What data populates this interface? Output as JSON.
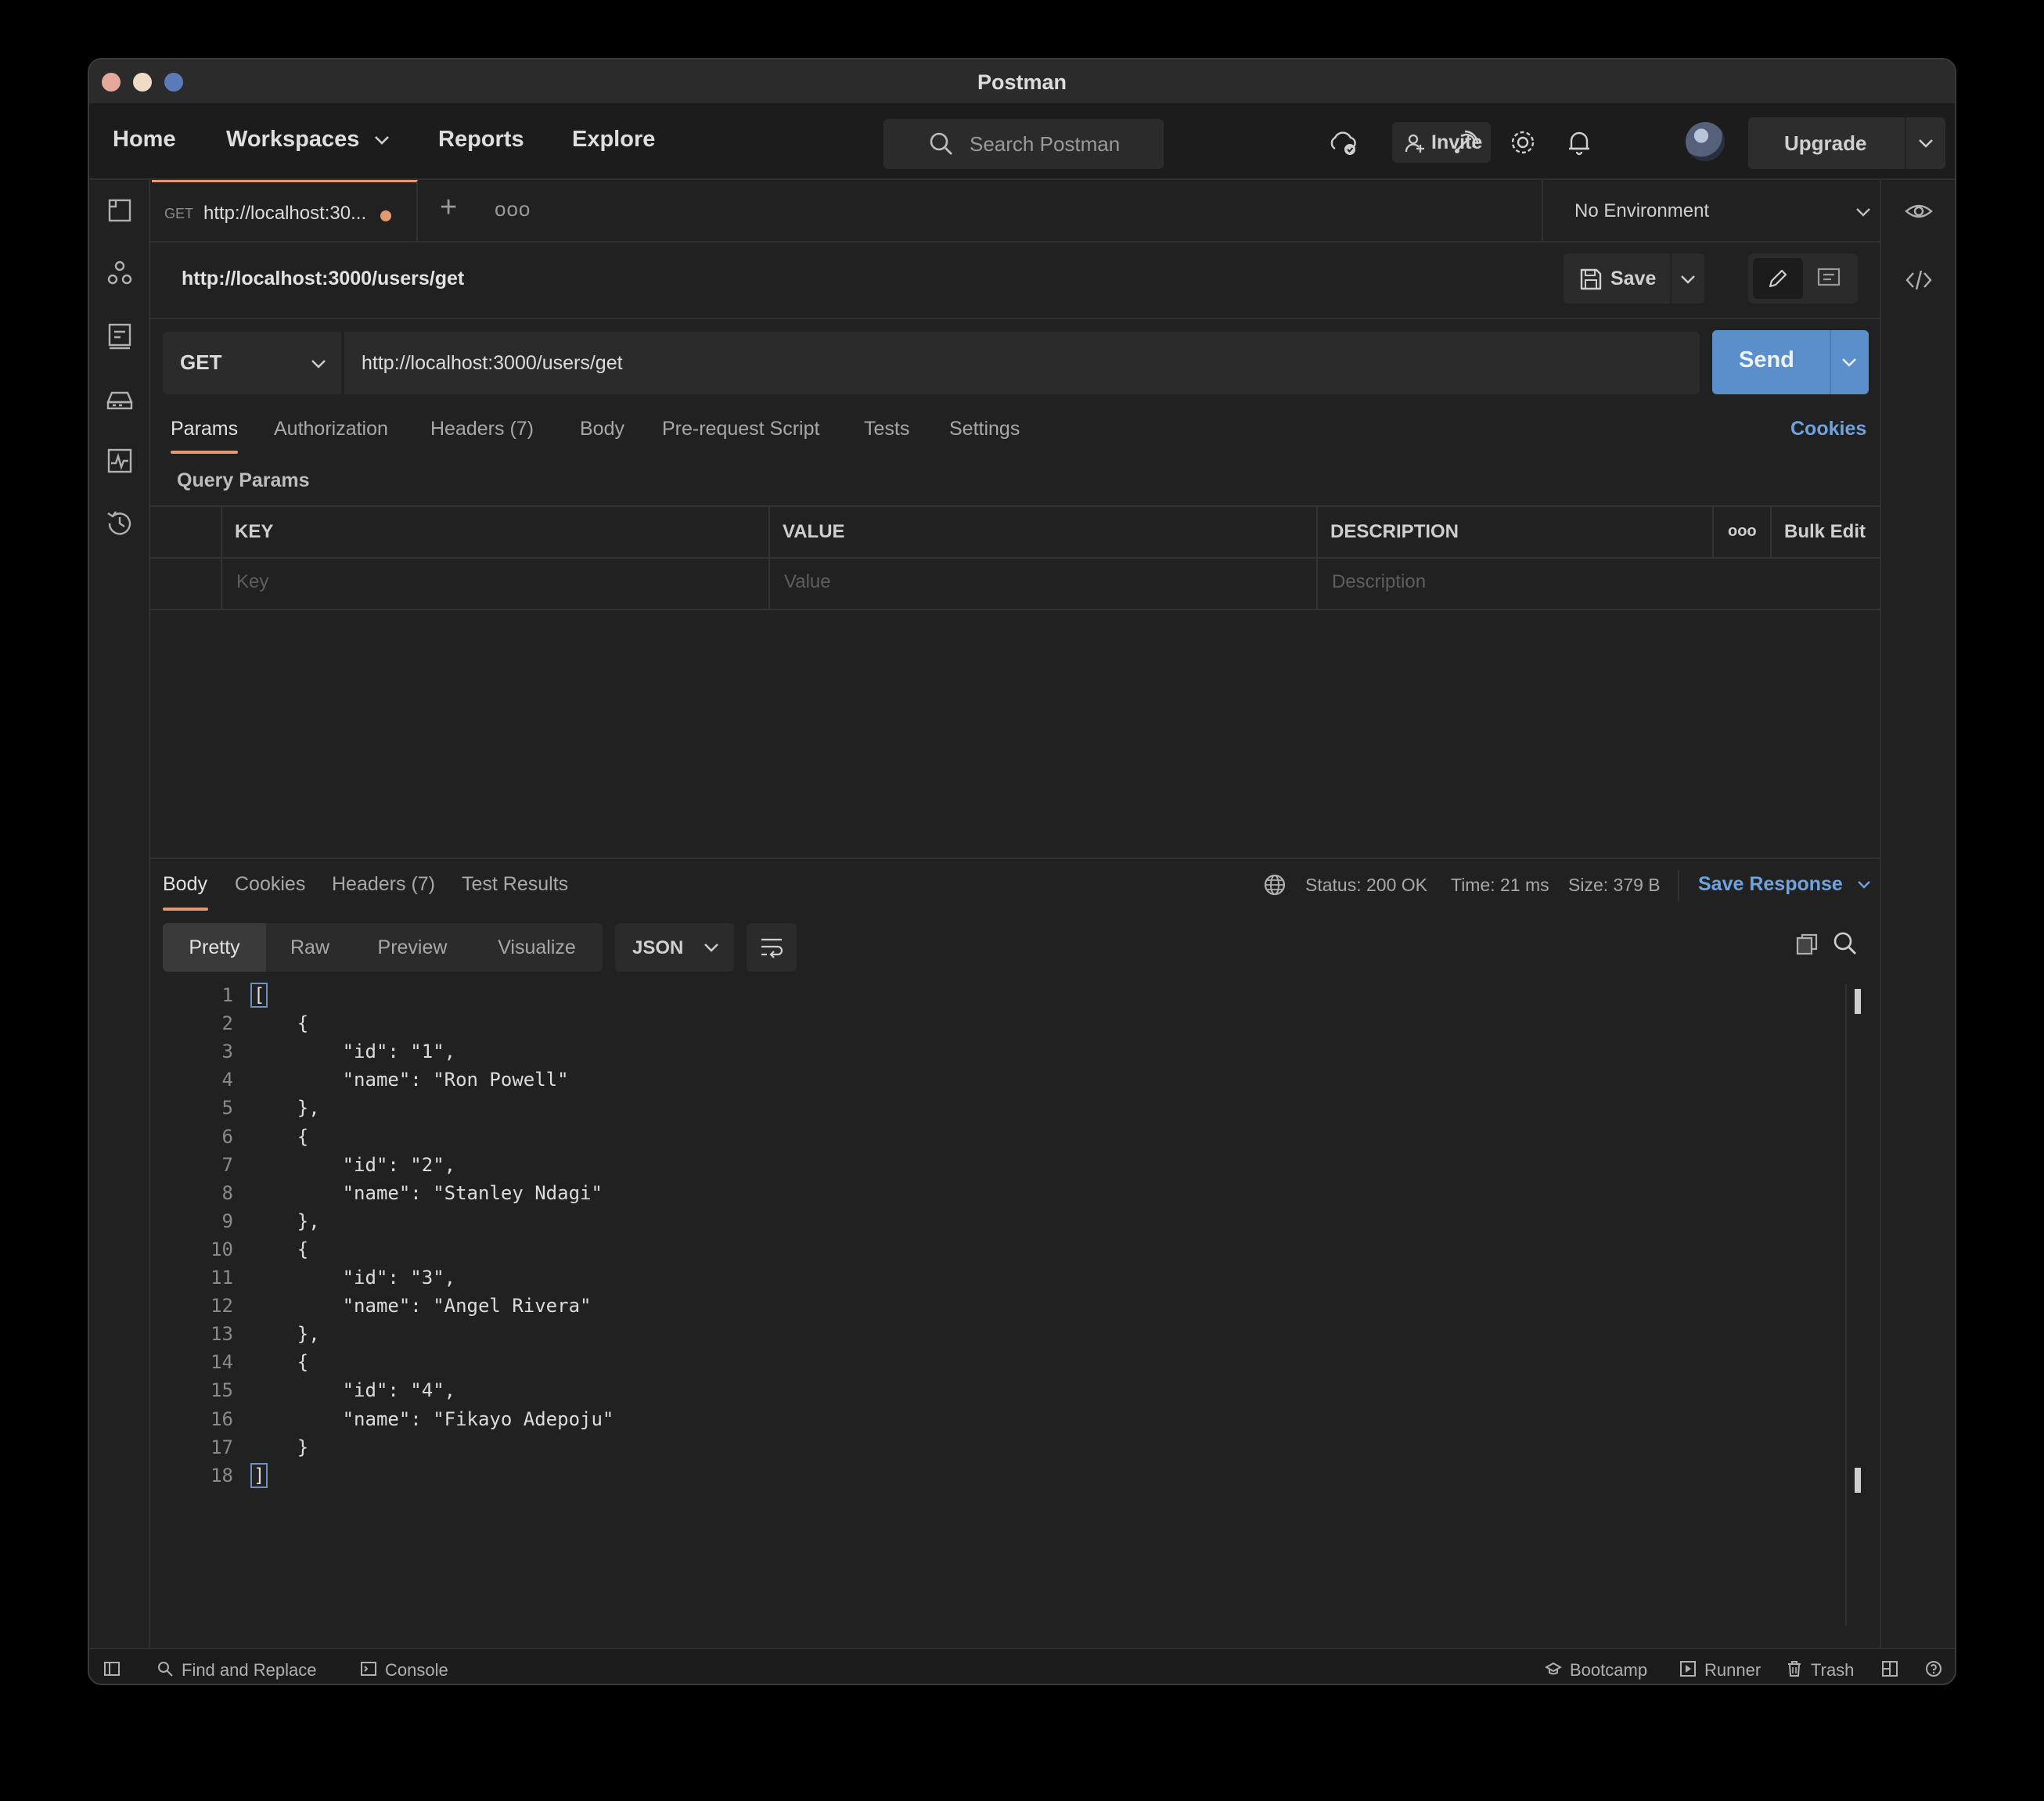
{
  "window": {
    "title": "Postman"
  },
  "header": {
    "nav": [
      "Home",
      "Workspaces",
      "Reports",
      "Explore"
    ],
    "search_placeholder": "Search Postman",
    "invite_label": "Invite",
    "upgrade_label": "Upgrade"
  },
  "tabs": {
    "active": {
      "method": "GET",
      "title": "http://localhost:30..."
    },
    "more": "ooo",
    "environment": "No Environment"
  },
  "request": {
    "title": "http://localhost:3000/users/get",
    "save_label": "Save",
    "method": "GET",
    "url": "http://localhost:3000/users/get",
    "send_label": "Send",
    "tabs": [
      "Params",
      "Authorization",
      "Headers (7)",
      "Body",
      "Pre-request Script",
      "Tests",
      "Settings"
    ],
    "cookies_label": "Cookies",
    "query_params_label": "Query Params",
    "params_table": {
      "headers": [
        "KEY",
        "VALUE",
        "DESCRIPTION"
      ],
      "placeholders": [
        "Key",
        "Value",
        "Description"
      ],
      "more": "ooo",
      "bulk_edit": "Bulk Edit"
    }
  },
  "response": {
    "tabs": [
      "Body",
      "Cookies",
      "Headers (7)",
      "Test Results"
    ],
    "status": "Status: 200 OK",
    "time": "Time: 21 ms",
    "size": "Size: 379 B",
    "save_response": "Save Response",
    "view_modes": [
      "Pretty",
      "Raw",
      "Preview",
      "Visualize"
    ],
    "format": "JSON",
    "code_lines": [
      "[",
      "    {",
      "        \"id\": \"1\",",
      "        \"name\": \"Ron Powell\"",
      "    },",
      "    {",
      "        \"id\": \"2\",",
      "        \"name\": \"Stanley Ndagi\"",
      "    },",
      "    {",
      "        \"id\": \"3\",",
      "        \"name\": \"Angel Rivera\"",
      "    },",
      "    {",
      "        \"id\": \"4\",",
      "        \"name\": \"Fikayo Adepoju\"",
      "    }",
      "]"
    ]
  },
  "statusbar": {
    "left": [
      "Find and Replace",
      "Console"
    ],
    "right": [
      "Bootcamp",
      "Runner",
      "Trash"
    ]
  },
  "colors": {
    "accent": "#e39a73",
    "send": "#5b8fcc",
    "link": "#6ea3e0",
    "background": "#212121"
  }
}
